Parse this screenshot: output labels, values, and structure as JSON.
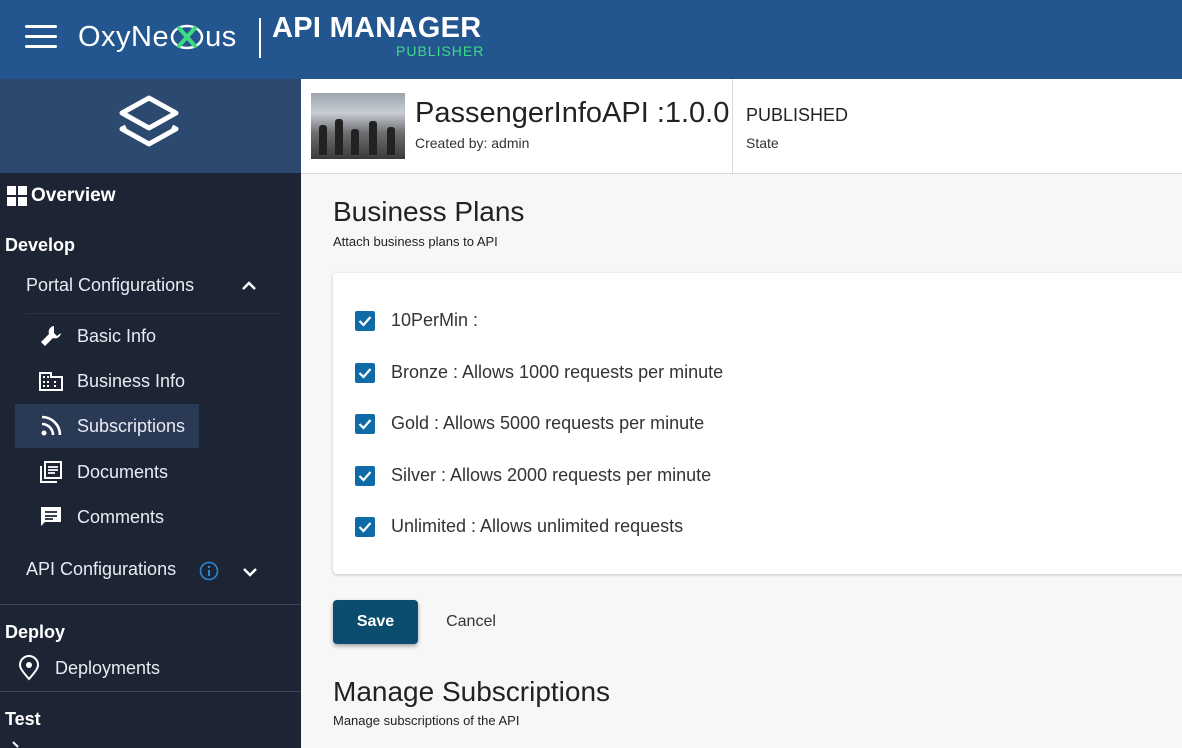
{
  "topbar": {
    "brand_prefix": "OxyNe",
    "brand_suffix": "us",
    "app_name": "API MANAGER",
    "app_sub": "PUBLISHER",
    "accent": "#3ddc84",
    "bg": "#23568e"
  },
  "sidebar": {
    "overview": "Overview",
    "develop": "Develop",
    "portal_configurations": "Portal Configurations",
    "items": [
      {
        "label": "Basic Info",
        "icon": "wrench-icon"
      },
      {
        "label": "Business Info",
        "icon": "building-icon"
      },
      {
        "label": "Subscriptions",
        "icon": "rss-icon",
        "active": true
      },
      {
        "label": "Documents",
        "icon": "documents-icon"
      },
      {
        "label": "Comments",
        "icon": "comment-icon"
      }
    ],
    "api_configurations": "API Configurations",
    "deploy": "Deploy",
    "deployments": "Deployments",
    "test": "Test"
  },
  "header": {
    "api_name": "PassengerInfoAPI :1.0.0",
    "created_by": "Created by: admin",
    "state_value": "PUBLISHED",
    "state_label": "State"
  },
  "business_plans": {
    "title": "Business Plans",
    "subtitle": "Attach business plans to API",
    "plans": [
      {
        "label": "10PerMin :",
        "checked": true
      },
      {
        "label": "Bronze : Allows 1000 requests per minute",
        "checked": true
      },
      {
        "label": "Gold : Allows 5000 requests per minute",
        "checked": true
      },
      {
        "label": "Silver : Allows 2000 requests per minute",
        "checked": true
      },
      {
        "label": "Unlimited : Allows unlimited requests",
        "checked": true
      }
    ]
  },
  "actions": {
    "save": "Save",
    "cancel": "Cancel"
  },
  "manage_subscriptions": {
    "title": "Manage Subscriptions",
    "subtitle": "Manage subscriptions of the API"
  }
}
